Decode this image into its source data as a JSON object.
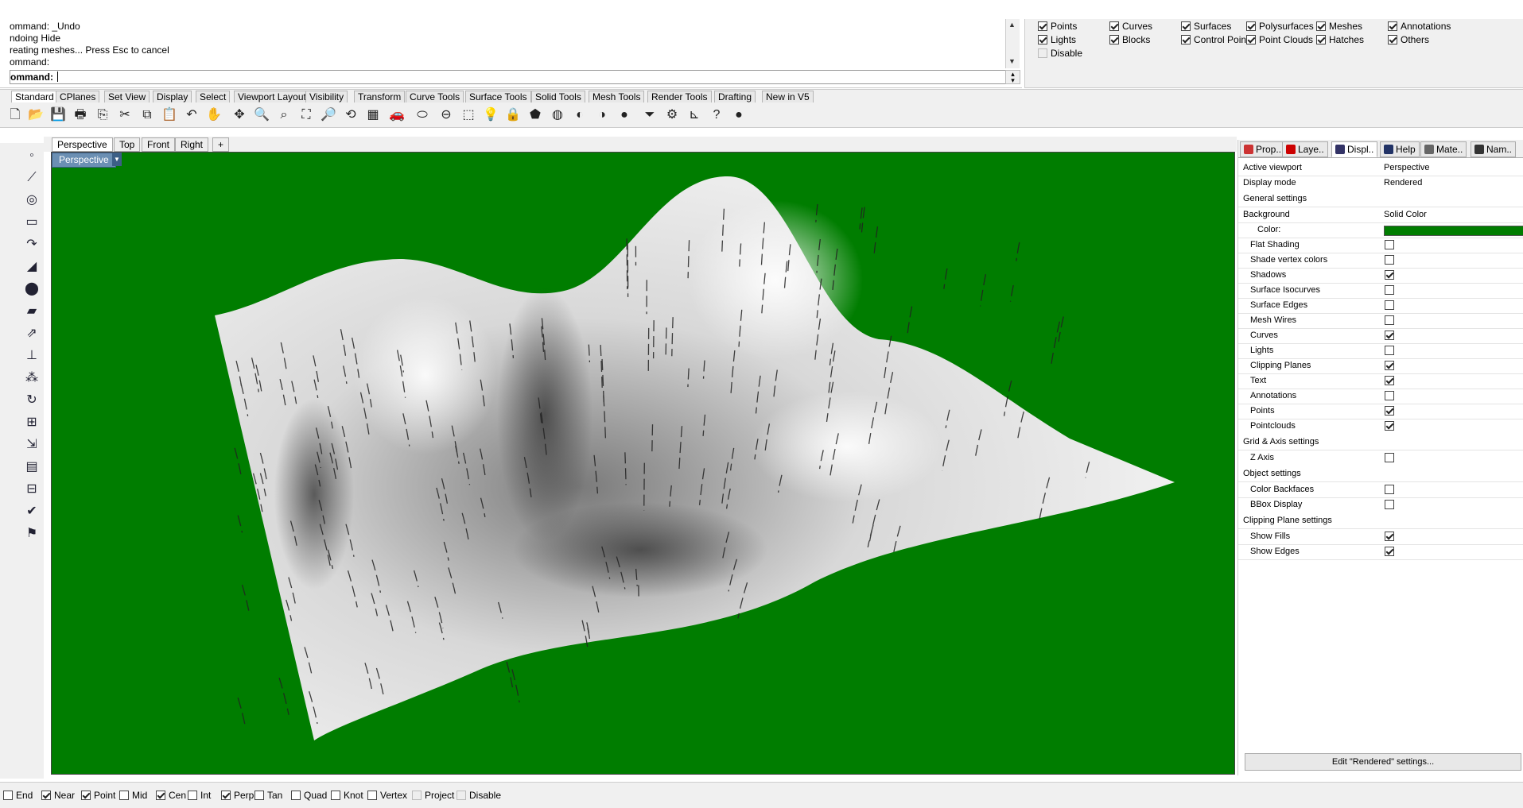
{
  "command_history": [
    "ommand: _Undo",
    "ndoing Hide",
    "reating meshes... Press Esc to cancel",
    "ommand:"
  ],
  "command_prompt": "ommand:",
  "filter": {
    "items": [
      {
        "label": "Points",
        "checked": true
      },
      {
        "label": "Curves",
        "checked": true
      },
      {
        "label": "Surfaces",
        "checked": true
      },
      {
        "label": "Polysurfaces",
        "checked": true
      },
      {
        "label": "Meshes",
        "checked": true
      },
      {
        "label": "Annotations",
        "checked": true
      },
      {
        "label": "Lights",
        "checked": true
      },
      {
        "label": "Blocks",
        "checked": true
      },
      {
        "label": "Control Points",
        "checked": true
      },
      {
        "label": "Point Clouds",
        "checked": true
      },
      {
        "label": "Hatches",
        "checked": true
      },
      {
        "label": "Others",
        "checked": true
      },
      {
        "label": "Disable",
        "checked": false
      }
    ]
  },
  "toolbar_tabs": [
    "Standard",
    "CPlanes",
    "Set View",
    "Display",
    "Select",
    "Viewport Layout",
    "Visibility",
    "Transform",
    "Curve Tools",
    "Surface Tools",
    "Solid Tools",
    "Mesh Tools",
    "Render Tools",
    "Drafting",
    "New in V5"
  ],
  "viewport_tabs": [
    "Perspective",
    "Top",
    "Front",
    "Right",
    "+"
  ],
  "viewport": {
    "label": "Perspective",
    "background": "#007d00"
  },
  "panel_tabs": [
    "Prop..",
    "Laye..",
    "Displ..",
    "Help",
    "Mate..",
    "Nam.."
  ],
  "display": {
    "active_viewport_label": "Active viewport",
    "active_viewport": "Perspective",
    "display_mode_label": "Display mode",
    "display_mode": "Rendered",
    "general_header": "General settings",
    "background_label": "Background",
    "background": "Solid Color",
    "color_label": "Color:",
    "color": "#007d00",
    "general": [
      {
        "label": "Flat Shading",
        "checked": false
      },
      {
        "label": "Shade vertex colors",
        "checked": false
      },
      {
        "label": "Shadows",
        "checked": true
      },
      {
        "label": "Surface Isocurves",
        "checked": false
      },
      {
        "label": "Surface Edges",
        "checked": false
      },
      {
        "label": "Mesh Wires",
        "checked": false
      },
      {
        "label": "Curves",
        "checked": true
      },
      {
        "label": "Lights",
        "checked": false
      },
      {
        "label": "Clipping Planes",
        "checked": true
      },
      {
        "label": "Text",
        "checked": true
      },
      {
        "label": "Annotations",
        "checked": false
      },
      {
        "label": "Points",
        "checked": true
      },
      {
        "label": "Pointclouds",
        "checked": true
      }
    ],
    "grid_header": "Grid & Axis settings",
    "grid": [
      {
        "label": "Z Axis",
        "checked": false
      }
    ],
    "object_header": "Object settings",
    "object": [
      {
        "label": "Color Backfaces",
        "checked": false
      },
      {
        "label": "BBox Display",
        "checked": false
      }
    ],
    "clip_header": "Clipping Plane settings",
    "clip": [
      {
        "label": "Show Fills",
        "checked": true
      },
      {
        "label": "Show Edges",
        "checked": true
      }
    ],
    "edit_button": "Edit \"Rendered\" settings..."
  },
  "osnaps": [
    {
      "label": "End",
      "checked": false
    },
    {
      "label": "Near",
      "checked": true
    },
    {
      "label": "Point",
      "checked": true
    },
    {
      "label": "Mid",
      "checked": false
    },
    {
      "label": "Cen",
      "checked": true
    },
    {
      "label": "Int",
      "checked": false
    },
    {
      "label": "Perp",
      "checked": true
    },
    {
      "label": "Tan",
      "checked": false
    },
    {
      "label": "Quad",
      "checked": false
    },
    {
      "label": "Knot",
      "checked": false
    },
    {
      "label": "Vertex",
      "checked": false
    },
    {
      "label": "Project",
      "checked": false,
      "dim": true
    },
    {
      "label": "Disable",
      "checked": false,
      "dim": true
    }
  ]
}
